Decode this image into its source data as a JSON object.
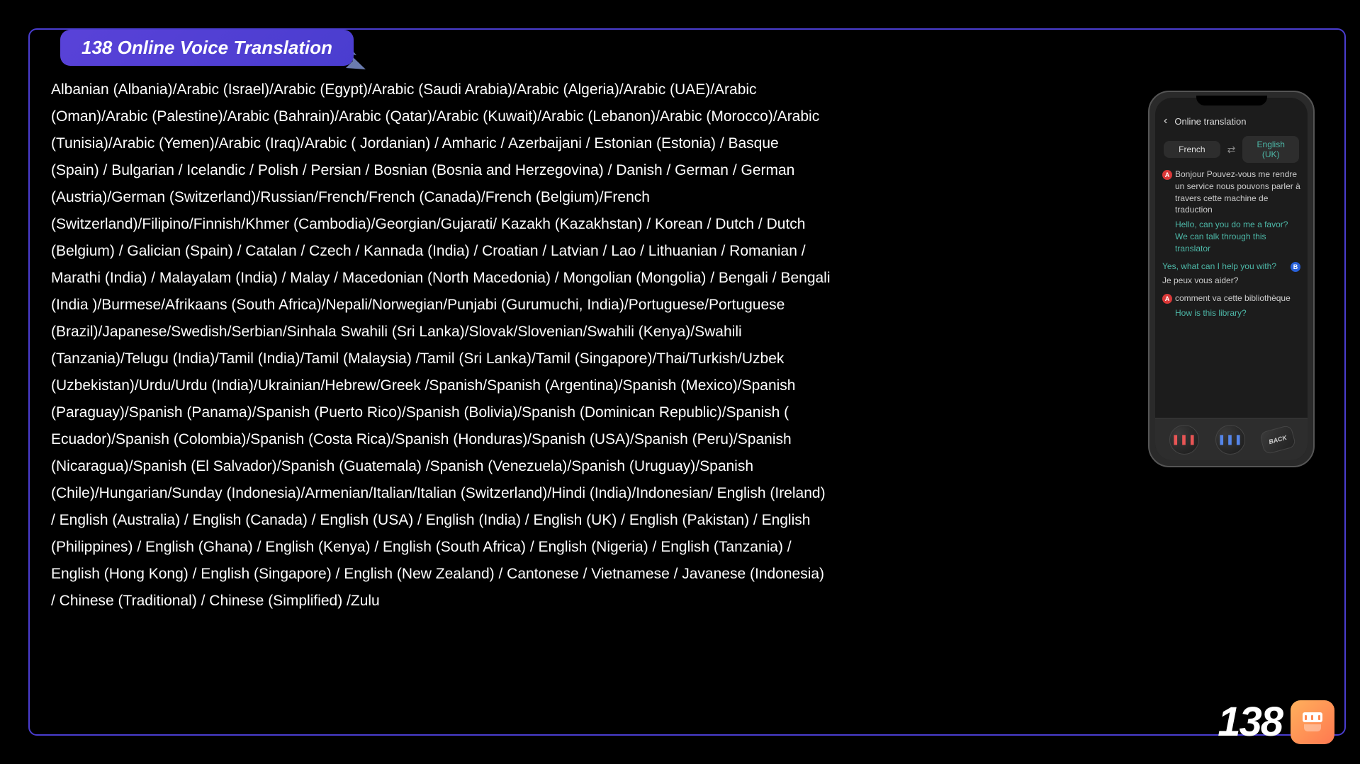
{
  "header": {
    "title": "138 Online Voice Translation"
  },
  "languages_text": "Albanian (Albania)/Arabic (Israel)/Arabic (Egypt)/Arabic (Saudi Arabia)/Arabic (Algeria)/Arabic (UAE)/Arabic (Oman)/Arabic (Palestine)/Arabic (Bahrain)/Arabic (Qatar)/Arabic (Kuwait)/Arabic (Lebanon)/Arabic (Morocco)/Arabic (Tunisia)/Arabic (Yemen)/Arabic (Iraq)/Arabic ( Jordanian) / Amharic / Azerbaijani / Estonian (Estonia) / Basque (Spain) / Bulgarian / Icelandic / Polish / Persian / Bosnian (Bosnia and Herzegovina) / Danish / German / German (Austria)/German (Switzerland)/Russian/French/French (Canada)/French (Belgium)/French (Switzerland)/Filipino/Finnish/Khmer (Cambodia)/Georgian/Gujarati/ Kazakh (Kazakhstan) / Korean / Dutch / Dutch (Belgium) / Galician (Spain) / Catalan / Czech / Kannada (India) / Croatian / Latvian / Lao / Lithuanian / Romanian / Marathi (India) / Malayalam (India) / Malay / Macedonian (North Macedonia) / Mongolian (Mongolia) / Bengali / Bengali (India )/Burmese/Afrikaans (South Africa)/Nepali/Norwegian/Punjabi (Gurumuchi, India)/Portuguese/Portuguese (Brazil)/Japanese/Swedish/Serbian/Sinhala Swahili (Sri Lanka)/Slovak/Slovenian/Swahili (Kenya)/Swahili (Tanzania)/Telugu (India)/Tamil (India)/Tamil (Malaysia) /Tamil (Sri Lanka)/Tamil (Singapore)/Thai/Turkish/Uzbek (Uzbekistan)/Urdu/Urdu (India)/Ukrainian/Hebrew/Greek /Spanish/Spanish (Argentina)/Spanish (Mexico)/Spanish (Paraguay)/Spanish (Panama)/Spanish (Puerto Rico)/Spanish (Bolivia)/Spanish (Dominican Republic)/Spanish ( Ecuador)/Spanish (Colombia)/Spanish (Costa Rica)/Spanish (Honduras)/Spanish (USA)/Spanish (Peru)/Spanish (Nicaragua)/Spanish (El Salvador)/Spanish (Guatemala) /Spanish (Venezuela)/Spanish (Uruguay)/Spanish (Chile)/Hungarian/Sunday (Indonesia)/Armenian/Italian/Italian (Switzerland)/Hindi (India)/Indonesian/ English (Ireland) / English (Australia) / English (Canada) / English (USA) / English (India) / English (UK) / English (Pakistan) / English (Philippines) / English (Ghana) / English (Kenya) / English (South Africa) / English (Nigeria) / English (Tanzania) / English (Hong Kong) / English (Singapore) / English (New Zealand) / Cantonese / Vietnamese / Javanese (Indonesia) / Chinese (Traditional) / Chinese (Simplified) /Zulu",
  "phone": {
    "screen_title": "Online translation",
    "lang_from": "French",
    "lang_to": "English (UK)",
    "messages": [
      {
        "speaker": "A",
        "orig": "Bonjour Pouvez-vous me rendre un service nous pouvons parler à travers cette machine de traduction",
        "trans": "Hello, can you do me a favor? We can talk through this translator"
      },
      {
        "speaker": "B",
        "orig": "Yes, what can I help you with?",
        "trans": "Je peux vous aider?"
      },
      {
        "speaker": "A",
        "orig": "comment va cette bibliothèque",
        "trans": "How is this library?"
      }
    ],
    "back_label": "BACK"
  },
  "footer": {
    "count": "138"
  }
}
